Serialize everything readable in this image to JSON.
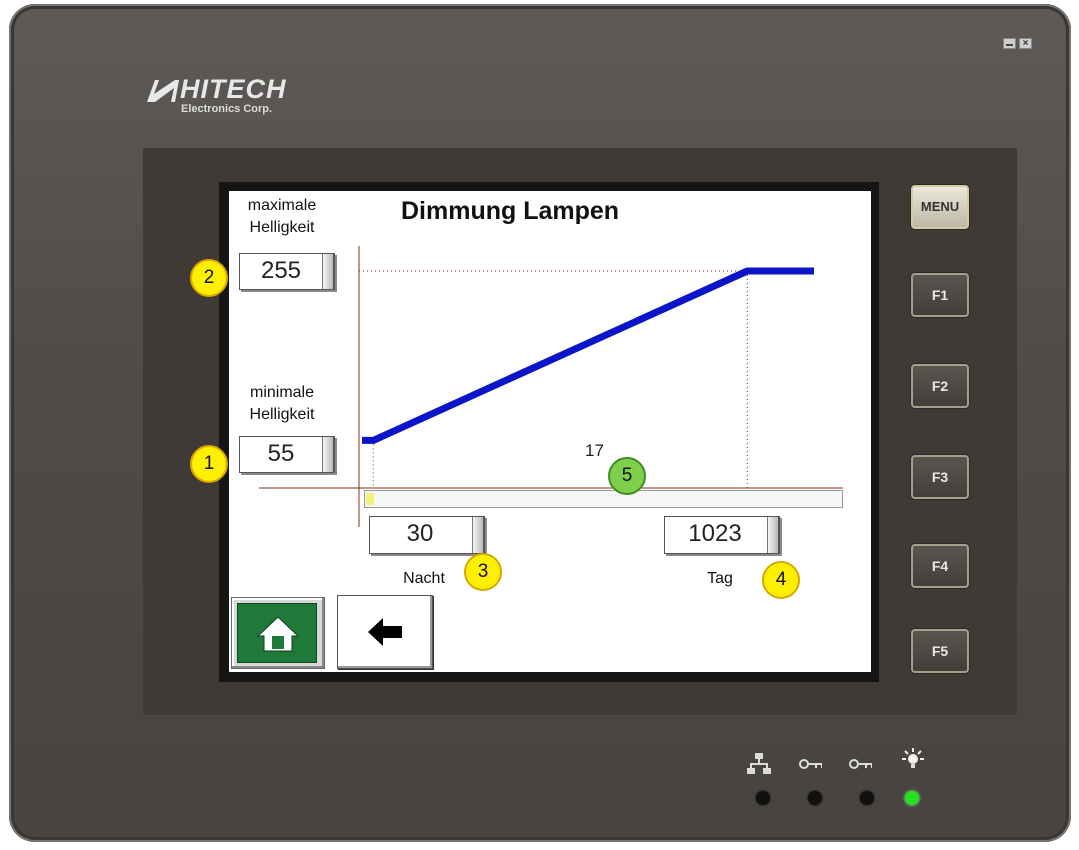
{
  "brand": {
    "name": "HITECH",
    "subtitle": "Electronics Corp."
  },
  "window_controls": {
    "close_glyph": "×"
  },
  "screen": {
    "title": "Dimmung Lampen",
    "max_label_line1": "maximale",
    "max_label_line2": "Helligkeit",
    "max_value": "255",
    "min_label_line1": "minimale",
    "min_label_line2": "Helligkeit",
    "min_value": "55",
    "night_value": "30",
    "night_label": "Nacht",
    "day_value": "1023",
    "day_label": "Tag",
    "current_value": "17",
    "current_level_fraction": 0.017
  },
  "chart_data": {
    "type": "line",
    "x": [
      0,
      30,
      1023,
      1200
    ],
    "y": [
      55,
      55,
      255,
      255
    ],
    "xlim": [
      0,
      1200
    ],
    "ylim": [
      0,
      300
    ],
    "title": "Dimmung Lampen",
    "series_color": "#0a14c8"
  },
  "nav": {
    "home_icon": "home-icon",
    "back_icon": "back-arrow-icon",
    "home_color": "#1f7a3a"
  },
  "function_keys": [
    "MENU",
    "F1",
    "F2",
    "F3",
    "F4",
    "F5"
  ],
  "badges": [
    "1",
    "2",
    "3",
    "4",
    "5"
  ],
  "status_icons": [
    "network-icon",
    "key-icon",
    "key-icon",
    "light-bulb-icon"
  ]
}
